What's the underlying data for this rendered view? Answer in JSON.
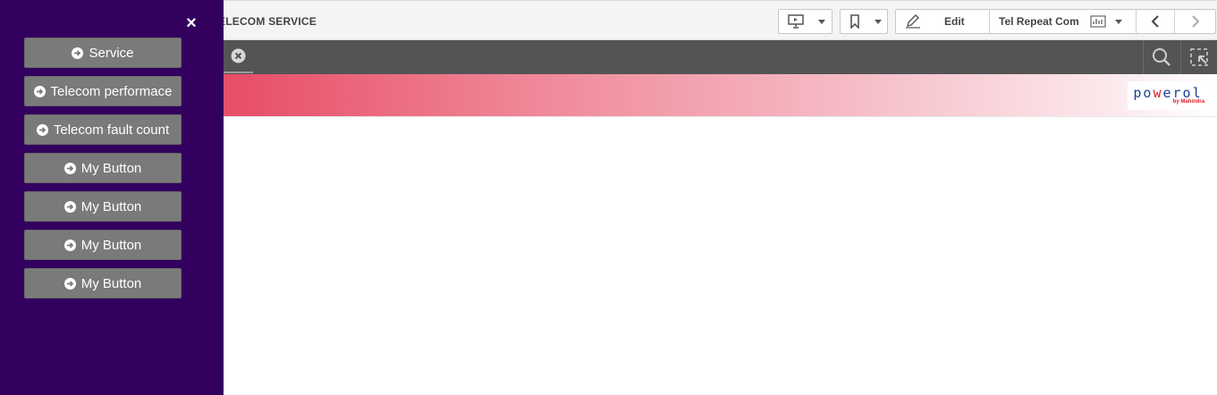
{
  "header": {
    "app_title": "ELECOM SERVICE",
    "edit_label": "Edit",
    "sheet_name": "Tel Repeat Com"
  },
  "drawer": {
    "close_glyph": "×",
    "buttons": [
      {
        "label": "Service",
        "icon": "circle-arrow-right-icon"
      },
      {
        "label": "Telecom performace",
        "icon": "circle-arrow-right-icon"
      },
      {
        "label": "Telecom fault count",
        "icon": "circle-arrow-right-icon"
      },
      {
        "label": "My Button",
        "icon": "circle-arrow-right-icon"
      },
      {
        "label": "My Button",
        "icon": "circle-arrow-right-icon"
      },
      {
        "label": "My Button",
        "icon": "circle-arrow-right-icon"
      },
      {
        "label": "My Button",
        "icon": "circle-arrow-right-icon"
      }
    ]
  },
  "logo": {
    "text_main": "po",
    "text_mid": "w",
    "text_end": "erol",
    "text_sub": "by Mahindra"
  },
  "colors": {
    "drawer_bg": "#33005f",
    "button_bg": "#7a7a7a",
    "selection_bar": "#545454",
    "banner_start": "#e8405a"
  }
}
